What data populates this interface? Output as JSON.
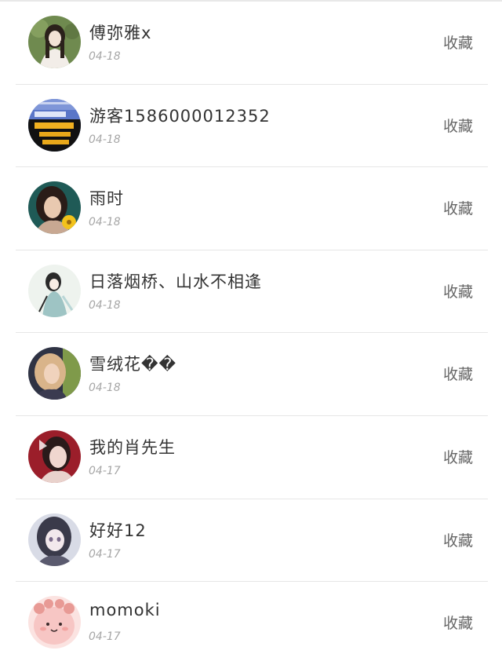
{
  "items": [
    {
      "name": "傅弥雅x",
      "date": "04-18",
      "action": "收藏",
      "avatar_icon": "girl-portrait-outdoor-avatar",
      "colors": [
        "#6f8a4f",
        "#f2ede8",
        "#2b211b"
      ]
    },
    {
      "name": "游客1586000012352",
      "date": "04-18",
      "action": "收藏",
      "avatar_icon": "fan-banner-avatar",
      "colors": [
        "#5a76c8",
        "#111111",
        "#e8a81a"
      ]
    },
    {
      "name": "雨时",
      "date": "04-18",
      "action": "收藏",
      "avatar_icon": "girl-with-flower-avatar",
      "colors": [
        "#1f5a56",
        "#e9c9b0",
        "#f2c21b"
      ]
    },
    {
      "name": "日落烟桥、山水不相逢",
      "date": "04-18",
      "action": "收藏",
      "avatar_icon": "ink-painting-lady-avatar",
      "colors": [
        "#eef3ee",
        "#9ec4c4",
        "#2a2a2a"
      ]
    },
    {
      "name": "雪绒花��",
      "date": "04-18",
      "action": "收藏",
      "avatar_icon": "blonde-girl-avatar",
      "colors": [
        "#2f3344",
        "#d9b48a",
        "#7f9a4a"
      ]
    },
    {
      "name": "我的肖先生",
      "date": "04-17",
      "action": "收藏",
      "avatar_icon": "girl-red-background-avatar",
      "colors": [
        "#9b1e2a",
        "#f0d6cf",
        "#2a1a1a"
      ]
    },
    {
      "name": "好好12",
      "date": "04-17",
      "action": "收藏",
      "avatar_icon": "anime-girl-avatar",
      "colors": [
        "#3a3a4a",
        "#d8dbe6",
        "#7a6a8a"
      ]
    },
    {
      "name": "momoki",
      "date": "04-17",
      "action": "收藏",
      "avatar_icon": "pink-cartoon-avatar",
      "colors": [
        "#f7c6c4",
        "#e89a95",
        "#ffffff"
      ]
    }
  ]
}
